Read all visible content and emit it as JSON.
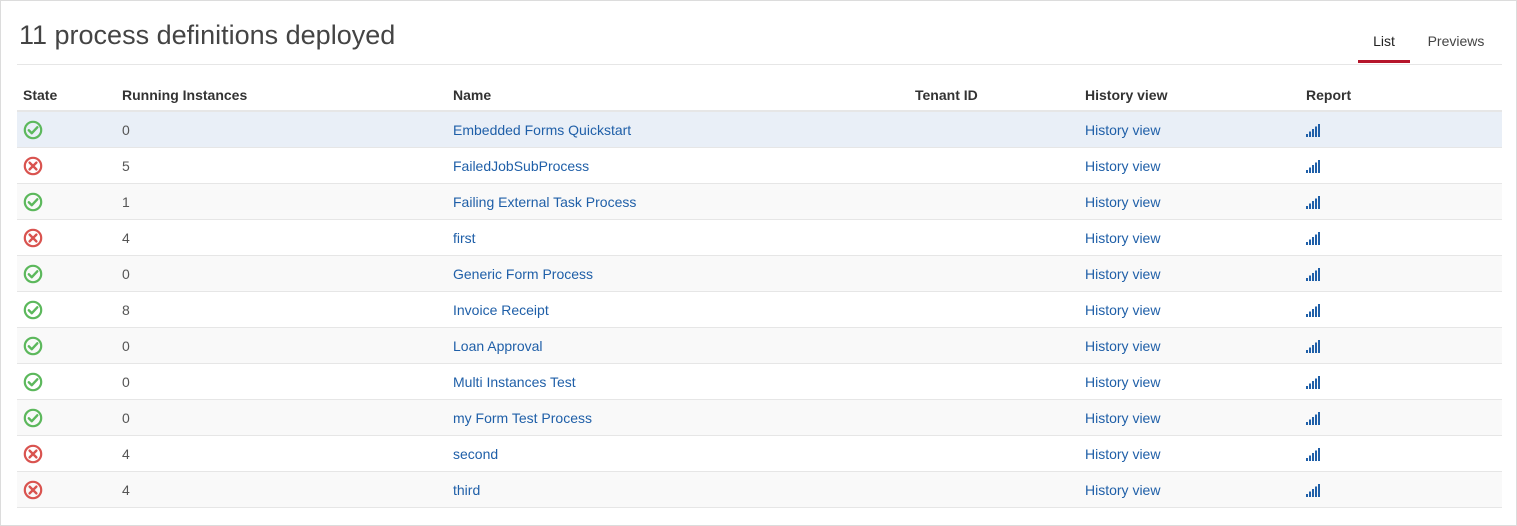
{
  "header": {
    "title": "11 process definitions deployed",
    "tabs": [
      {
        "label": "List",
        "active": true
      },
      {
        "label": "Previews",
        "active": false
      }
    ]
  },
  "table": {
    "columns": [
      "State",
      "Running Instances",
      "Name",
      "Tenant ID",
      "History view",
      "Report"
    ],
    "rows": [
      {
        "state": "ok",
        "running": "0",
        "name": "Embedded Forms Quickstart",
        "tenant": "",
        "history": "History view",
        "report": "bar-chart-icon"
      },
      {
        "state": "failed",
        "running": "5",
        "name": "FailedJobSubProcess",
        "tenant": "",
        "history": "History view",
        "report": "bar-chart-icon"
      },
      {
        "state": "ok",
        "running": "1",
        "name": "Failing External Task Process",
        "tenant": "",
        "history": "History view",
        "report": "bar-chart-icon"
      },
      {
        "state": "failed",
        "running": "4",
        "name": "first",
        "tenant": "",
        "history": "History view",
        "report": "bar-chart-icon"
      },
      {
        "state": "ok",
        "running": "0",
        "name": "Generic Form Process",
        "tenant": "",
        "history": "History view",
        "report": "bar-chart-icon"
      },
      {
        "state": "ok",
        "running": "8",
        "name": "Invoice Receipt",
        "tenant": "",
        "history": "History view",
        "report": "bar-chart-icon"
      },
      {
        "state": "ok",
        "running": "0",
        "name": "Loan Approval",
        "tenant": "",
        "history": "History view",
        "report": "bar-chart-icon"
      },
      {
        "state": "ok",
        "running": "0",
        "name": "Multi Instances Test",
        "tenant": "",
        "history": "History view",
        "report": "bar-chart-icon"
      },
      {
        "state": "ok",
        "running": "0",
        "name": "my Form Test Process",
        "tenant": "",
        "history": "History view",
        "report": "bar-chart-icon"
      },
      {
        "state": "failed",
        "running": "4",
        "name": "second",
        "tenant": "",
        "history": "History view",
        "report": "bar-chart-icon"
      },
      {
        "state": "failed",
        "running": "4",
        "name": "third",
        "tenant": "",
        "history": "History view",
        "report": "bar-chart-icon"
      }
    ]
  },
  "colors": {
    "ok": "#5cb85c",
    "failed": "#d9534f",
    "link": "#1f5fa8",
    "tab_active": "#b5152b",
    "row_highlight": "#e9eff7"
  }
}
